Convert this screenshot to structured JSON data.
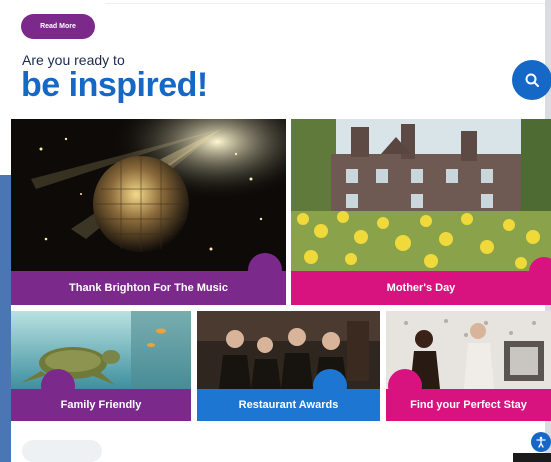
{
  "page": {
    "read_more_label": "Read More",
    "kicker": "Are you ready to",
    "headline": "be inspired!",
    "colors": {
      "purple": "#7b2a8c",
      "pink": "#d8127e",
      "blue": "#1668c7",
      "bright_blue": "#1c76d2"
    }
  },
  "search": {
    "icon": "search-icon"
  },
  "tiles": [
    {
      "label": "Thank Brighton For The Music",
      "color": "#7b2a8c"
    },
    {
      "label": "Mother's Day",
      "color": "#d8127e"
    },
    {
      "label": "Family Friendly",
      "color": "#7b2a8c"
    },
    {
      "label": "Restaurant Awards",
      "color": "#1c76d2"
    },
    {
      "label": "Find your Perfect Stay",
      "color": "#d8127e"
    }
  ],
  "accessibility": {
    "icon": "accessibility-icon"
  }
}
